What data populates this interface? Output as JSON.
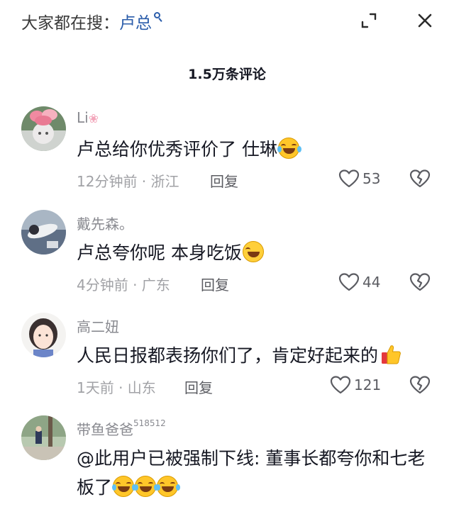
{
  "header": {
    "search_prefix": "大家都在搜：",
    "search_term": "卢总",
    "icons": {
      "search": "search-icon",
      "expand": "expand-icon",
      "close": "close-icon"
    }
  },
  "comment_count": "1.5万条评论",
  "comments": [
    {
      "author": "Li",
      "author_badge": "",
      "content": "卢总给你优秀评价了 仕琳",
      "emojis": [
        "laughing-crying-emoji"
      ],
      "time_location": "12分钟前 · 浙江",
      "reply_label": "回复",
      "likes": "53"
    },
    {
      "author": "戴先森。",
      "author_badge": "",
      "content": "卢总夸你呢  本身吃饭",
      "emojis": [
        "woozy-emoji"
      ],
      "time_location": "4分钟前 · 广东",
      "reply_label": "回复",
      "likes": "44"
    },
    {
      "author": "高二妞",
      "author_badge": "",
      "content": "人民日报都表扬你们了，肯定好起来的",
      "emojis": [
        "thumbs-up-emoji"
      ],
      "time_location": "1天前 · 山东",
      "reply_label": "回复",
      "likes": "121"
    },
    {
      "author": "带鱼爸爸",
      "author_badge": "518512",
      "content": "@此用户已被强制下线: 董事长都夸你和七老板了",
      "emojis": [
        "laughing-crying-emoji",
        "laughing-crying-emoji",
        "laughing-crying-emoji"
      ],
      "time_location": "",
      "reply_label": "",
      "likes": ""
    }
  ],
  "colors": {
    "accent_blue": "#2a5caa",
    "text_primary": "#161823",
    "text_secondary": "#8a8b91",
    "emoji_yellow": "#ffc629"
  }
}
